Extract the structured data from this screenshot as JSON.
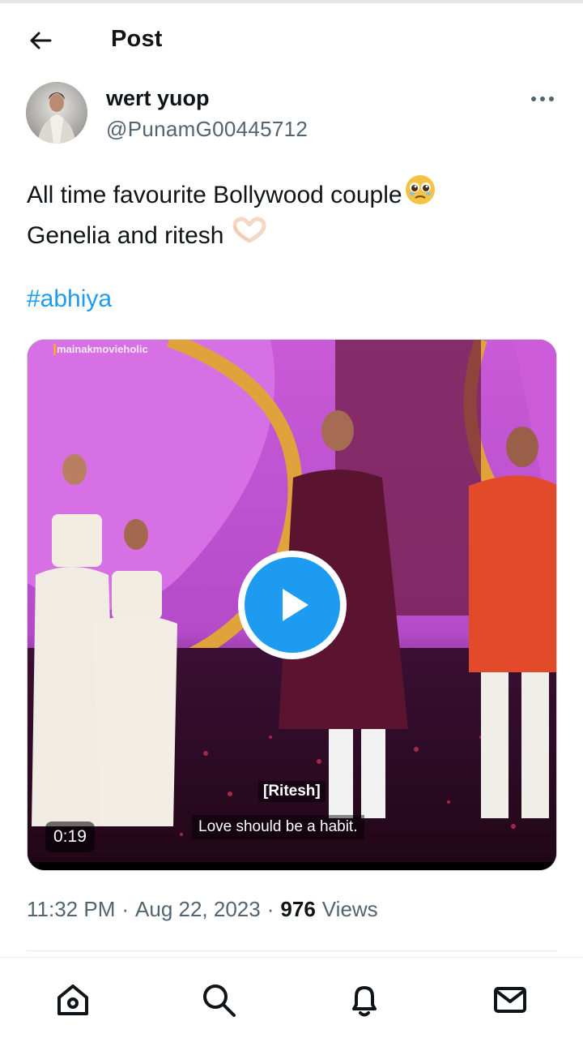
{
  "header": {
    "title": "Post",
    "back_icon": "arrow-left-icon"
  },
  "author": {
    "display_name": "wert yuop",
    "handle": "@PunamG00445712",
    "more_icon": "more-horizontal-icon"
  },
  "tweet": {
    "line1": "All time favourite Bollywood couple",
    "line1_emoji": "🥹",
    "line2": "Genelia and ritesh",
    "line2_emoji": "🫶🏻",
    "hashtag": "#abhiya"
  },
  "media": {
    "watermark": "mainakmovieholic",
    "caption_speaker": "[Ritesh]",
    "caption_text": "Love should be a habit.",
    "duration": "0:19",
    "play_icon": "play-icon"
  },
  "meta": {
    "time": "11:32 PM",
    "separator": "·",
    "date": "Aug 22, 2023",
    "views_count": "976",
    "views_label": "Views"
  },
  "nav": {
    "items": [
      "home-icon",
      "search-icon",
      "notifications-icon",
      "messages-icon"
    ]
  },
  "colors": {
    "accent": "#1d9bf0",
    "text_primary": "#0f1419",
    "text_secondary": "#536471"
  }
}
